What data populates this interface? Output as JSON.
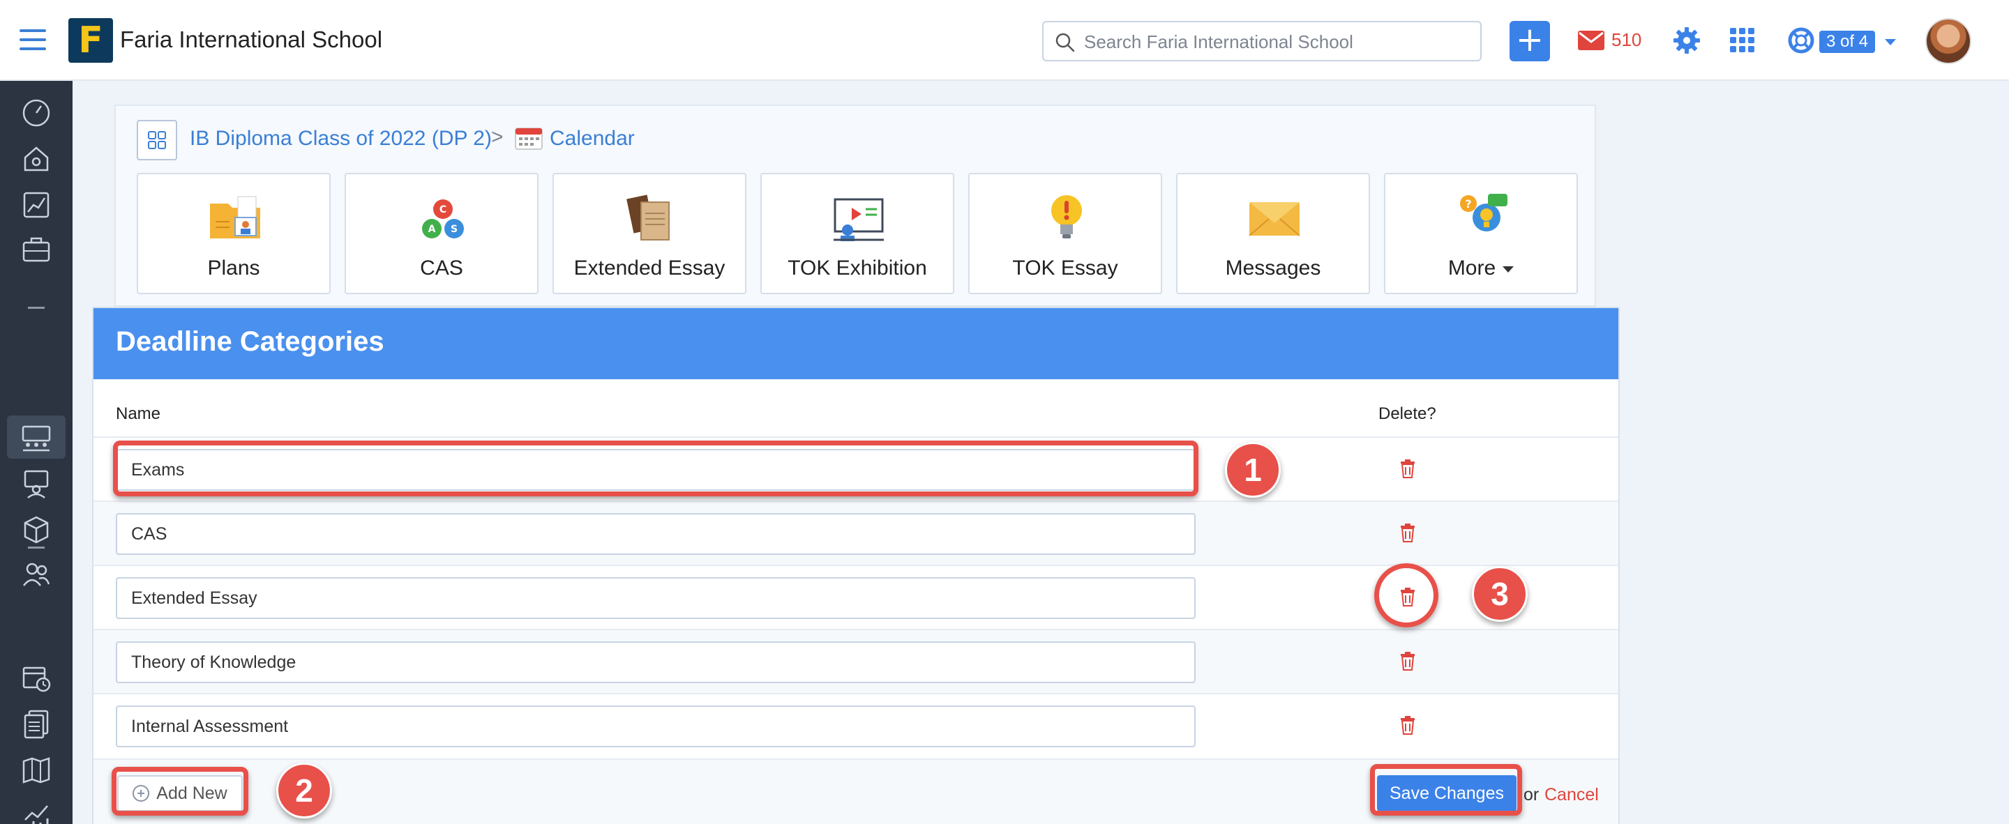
{
  "header": {
    "school_name": "Faria International School",
    "logo_letter": "F",
    "search_placeholder": "Search Faria International School",
    "add_label": "+",
    "mail_count": "510",
    "steps_badge": "3 of 4"
  },
  "breadcrumb": {
    "class_name": "IB Diploma Class of 2022 (DP 2)",
    "separator": ">",
    "page": "Calendar"
  },
  "tiles": [
    {
      "label": "Plans",
      "icon": "plans-folder-icon"
    },
    {
      "label": "CAS",
      "icon": "cas-triangle-icon"
    },
    {
      "label": "Extended Essay",
      "icon": "extended-essay-books-icon"
    },
    {
      "label": "TOK Exhibition",
      "icon": "tok-exhibition-presentation-icon"
    },
    {
      "label": "TOK Essay",
      "icon": "tok-essay-lightbulb-icon"
    },
    {
      "label": "Messages",
      "icon": "messages-envelope-icon"
    },
    {
      "label": "More",
      "icon": "more-people-icon"
    }
  ],
  "card": {
    "title": "Deadline Categories",
    "col_name": "Name",
    "col_delete": "Delete?",
    "rows": [
      {
        "value": "Exams"
      },
      {
        "value": "CAS"
      },
      {
        "value": "Extended Essay"
      },
      {
        "value": "Theory of Knowledge"
      },
      {
        "value": "Internal Assessment"
      }
    ],
    "add_new": "Add New",
    "save": "Save Changes",
    "or": "or",
    "cancel": "Cancel"
  },
  "annotations": {
    "one": "1",
    "two": "2",
    "three": "3",
    "color": "#e8504a"
  },
  "colors": {
    "accent": "#3b82e8",
    "header_band": "#4a90ee",
    "sidebar": "#2b3440",
    "danger": "#e0443c"
  }
}
